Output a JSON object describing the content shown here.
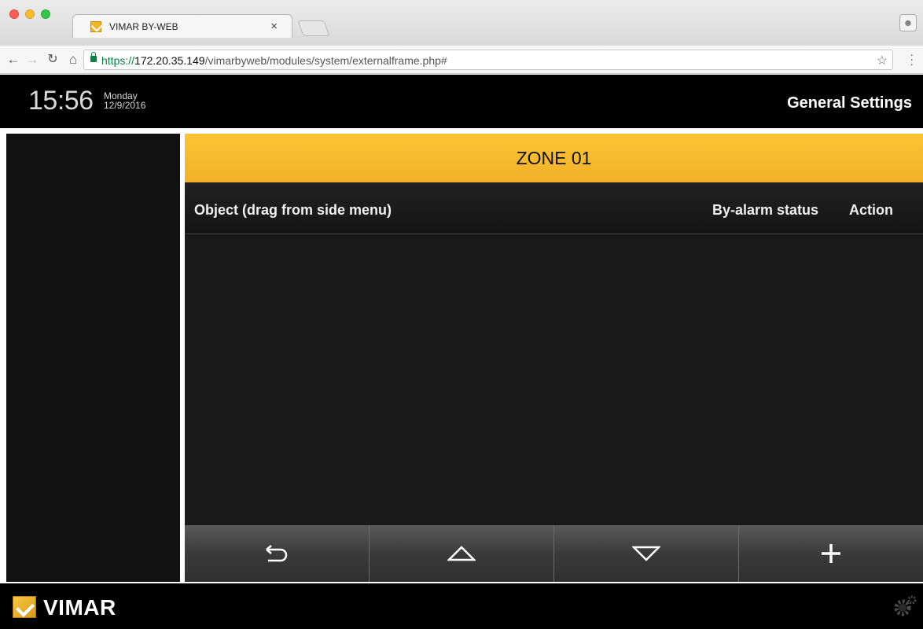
{
  "browser": {
    "tab_title": "VIMAR BY-WEB",
    "tab_close": "×",
    "url_scheme": "https://",
    "url_host": "172.20.35.149",
    "url_path": "/vimarbyweb/modules/system/externalframe.php#"
  },
  "header": {
    "time": "15:56",
    "weekday": "Monday",
    "date": "12/9/2016",
    "title": "General Settings"
  },
  "zone": {
    "title": "ZONE 01"
  },
  "columns": {
    "object": "Object (drag from side menu)",
    "status": "By-alarm status",
    "action": "Action"
  },
  "footer": {
    "brand": "VIMAR"
  },
  "icons": {
    "back": "return-arrow-icon",
    "up": "triangle-up-icon",
    "down": "triangle-down-icon",
    "add": "plus-icon",
    "settings": "gear-icon"
  },
  "colors": {
    "zone_header": "#f7bc2d",
    "brand": "#f1b626"
  }
}
